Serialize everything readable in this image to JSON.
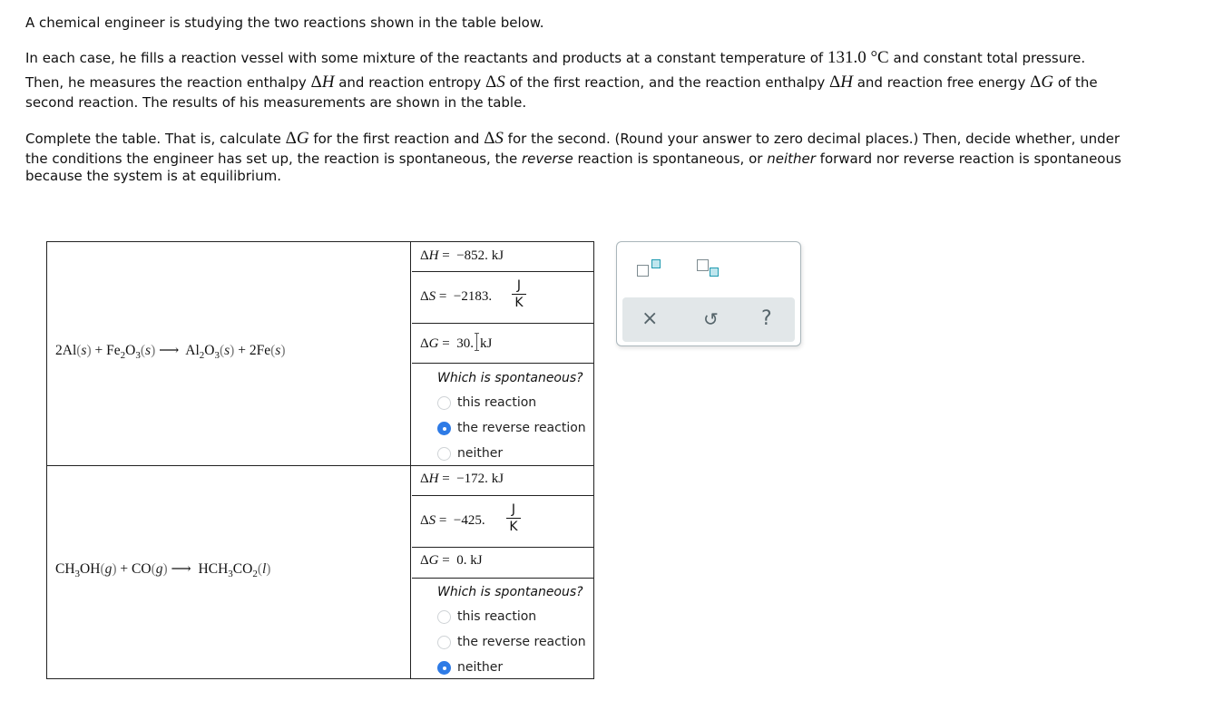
{
  "intro": {
    "line1": "A chemical engineer is studying the two reactions shown in the table below.",
    "p2_a": "In each case, he fills a reaction vessel with some mixture of the reactants and products at a constant temperature of ",
    "temperature": "131.0 °C",
    "p2_b": " and constant total pressure.",
    "p2_c": "Then, he measures the reaction enthalpy ",
    "p2_d": " and reaction entropy ",
    "p2_e": " of the first reaction, and the reaction enthalpy ",
    "p2_f": " and reaction free energy ",
    "p2_g": " of the",
    "p2_h": "second reaction. The results of his measurements are shown in the table.",
    "p3_a": "Complete the table. That is, calculate ",
    "p3_b": " for the first reaction and ",
    "p3_c": " for the second. (Round your answer to zero decimal places.) Then, decide whether, under",
    "p3_d": "the conditions the engineer has set up, the reaction is spontaneous, the ",
    "p3_reverse": "reverse",
    "p3_e": " reaction is spontaneous, or ",
    "p3_neither": "neither",
    "p3_f": " forward nor reverse reaction is spontaneous",
    "p3_g": "because the system is at equilibrium.",
    "sym_dH": "H",
    "sym_dS": "S",
    "sym_dG": "G",
    "delta": "Δ"
  },
  "reactions": [
    {
      "equation": {
        "lhs": [
          {
            "coef": "2",
            "formula": [
              "Al"
            ],
            "phase": "s"
          },
          {
            "coef": "",
            "formula": [
              "Fe",
              "2",
              "O",
              "3"
            ],
            "phase": "s"
          }
        ],
        "rhs": [
          {
            "coef": "",
            "formula": [
              "Al",
              "2",
              "O",
              "3"
            ],
            "phase": "s"
          },
          {
            "coef": "2",
            "formula": [
              "Fe"
            ],
            "phase": "s"
          }
        ]
      },
      "dH": {
        "value": "−852.",
        "unit": "kJ"
      },
      "dS": {
        "value": "−2183.",
        "unit_num": "J",
        "unit_den": "K"
      },
      "dG": {
        "value": "30.",
        "unit": "kJ"
      },
      "question": "Which is spontaneous?",
      "options": [
        "this reaction",
        "the reverse reaction",
        "neither"
      ],
      "selected": 1
    },
    {
      "equation": {
        "lhs": [
          {
            "coef": "",
            "formula": [
              "CH",
              "3",
              "OH"
            ],
            "phase": "g"
          },
          {
            "coef": "",
            "formula": [
              "CO"
            ],
            "phase": "g"
          }
        ],
        "rhs": [
          {
            "coef": "",
            "formula": [
              "HCH",
              "3",
              "CO",
              "2"
            ],
            "phase": "l"
          }
        ]
      },
      "dH": {
        "value": "−172.",
        "unit": "kJ"
      },
      "dS": {
        "value": "−425.",
        "unit_num": "J",
        "unit_den": "K"
      },
      "dG": {
        "value": "0.",
        "unit": "kJ"
      },
      "question": "Which is spontaneous?",
      "options": [
        "this reaction",
        "the reverse reaction",
        "neither"
      ],
      "selected": 2
    }
  ],
  "labels": {
    "eq": "=",
    "plus": "+",
    "arrow": "⟶"
  },
  "toolbar": {
    "superscript_icon": "superscript-icon",
    "subscript_icon": "subscript-icon",
    "clear": "×",
    "undo": "↺",
    "help": "?"
  },
  "colors": {
    "radio_selected": "#2e7be6",
    "tool_accent": "#1f9ab0",
    "tool_bar_bg": "#e2e7e9"
  }
}
